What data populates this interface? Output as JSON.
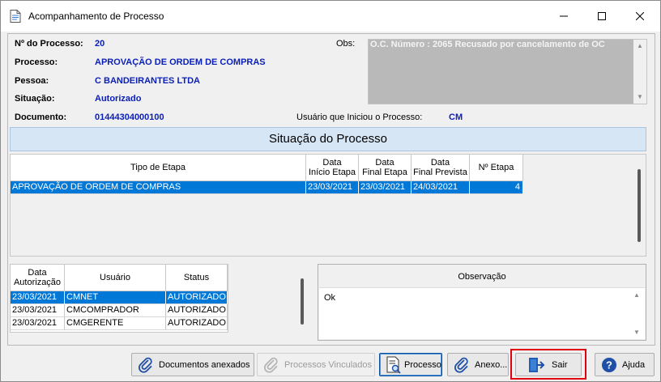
{
  "window": {
    "title": "Acompanhamento de Processo",
    "minimize_icon": "minimize-icon",
    "maximize_icon": "maximize-icon",
    "close_icon": "close-icon"
  },
  "header": {
    "numero_label": "Nº do Processo:",
    "numero_value": "20",
    "processo_label": "Processo:",
    "processo_value": "APROVAÇÃO DE ORDEM DE COMPRAS",
    "pessoa_label": "Pessoa:",
    "pessoa_value": "C BANDEIRANTES LTDA",
    "situacao_label": "Situação:",
    "situacao_value": "Autorizado",
    "documento_label": "Documento:",
    "documento_value": "01444304000100",
    "usuario_label": "Usuário que Iniciou o Processo:",
    "usuario_value": "CM",
    "obs_label": "Obs:",
    "obs_value": "O.C. Número : 2065 Recusado por cancelamento de OC"
  },
  "section_title": "Situação do Processo",
  "stages_grid": {
    "columns": [
      "Tipo de Etapa",
      "Data\nInício Etapa",
      "Data\nFinal Etapa",
      "Data\nFinal Prevista",
      "Nº Etapa"
    ],
    "rows": [
      [
        "APROVAÇÃO DE ORDEM DE COMPRAS",
        "23/03/2021",
        "23/03/2021",
        "24/03/2021",
        "4"
      ]
    ]
  },
  "auth_grid": {
    "columns": [
      "Data\nAutorização",
      "Usuário",
      "Status"
    ],
    "rows": [
      [
        "23/03/2021",
        "CMNET",
        "AUTORIZADO"
      ],
      [
        "23/03/2021",
        "CMCOMPRADOR",
        "AUTORIZADO"
      ],
      [
        "23/03/2021",
        "CMGERENTE",
        "AUTORIZADO"
      ]
    ]
  },
  "observacao": {
    "title": "Observação",
    "text": "Ok"
  },
  "buttons": {
    "documentos": "Documentos anexados",
    "vinculados": "Processos Vinculados",
    "processo": "Processo",
    "anexo": "Anexo...",
    "sair": "Sair",
    "ajuda": "Ajuda"
  },
  "colors": {
    "value_text": "#0a1eb8",
    "selection": "#0078d7",
    "section_header": "#d7e6f5",
    "highlight_box": "#e1000f"
  }
}
